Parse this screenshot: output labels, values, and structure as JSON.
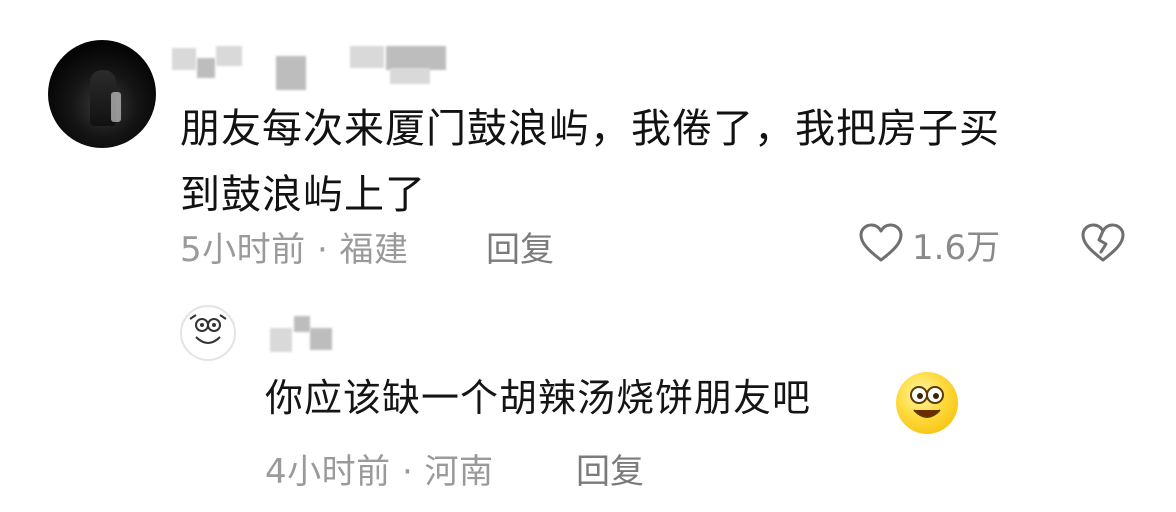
{
  "comment": {
    "text": "朋友每次来厦门鼓浪屿，我倦了，我把房子买\n到鼓浪屿上了",
    "time_location": "5小时前 · 福建",
    "reply_label": "回复",
    "like_count": "1.6万"
  },
  "reply": {
    "text": "你应该缺一个胡辣汤烧饼朋友吧",
    "time_location": "4小时前 · 河南",
    "reply_label": "回复"
  },
  "colors": {
    "text": "#121212",
    "meta": "#9a9a9a",
    "icon": "#6f6f6f"
  },
  "icons": [
    "heart-icon",
    "dislike-broken-heart-icon",
    "smile-emoji-icon"
  ]
}
